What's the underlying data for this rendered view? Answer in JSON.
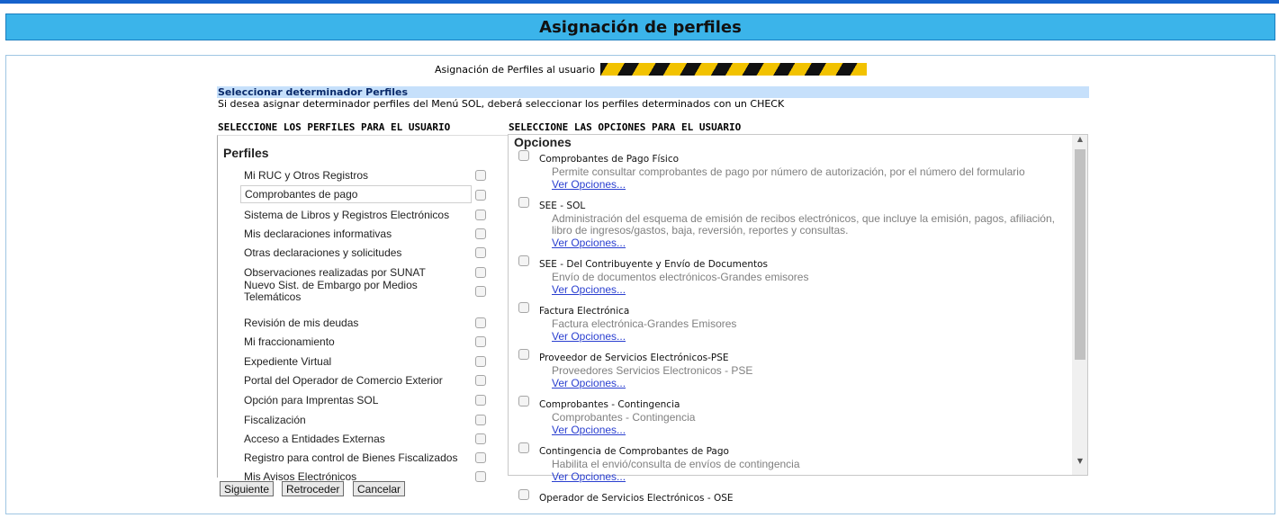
{
  "header": {
    "title": "Asignación de perfiles"
  },
  "user_row": {
    "label": "Asignación de Perfiles al usuario"
  },
  "section": {
    "heading": "Seleccionar determinador Perfiles",
    "description": "Si desea asignar determinador perfiles del Menú SOL, deberá seleccionar los perfiles determinados con un CHECK"
  },
  "perfiles": {
    "column_header": "SELECCIONE LOS PERFILES PARA EL USUARIO",
    "title": "Perfiles",
    "items": [
      {
        "label": "Mi RUC y Otros Registros"
      },
      {
        "label": "Comprobantes de pago"
      },
      {
        "label": "Sistema de Libros y Registros Electrónicos"
      },
      {
        "label": "Mis declaraciones informativas"
      },
      {
        "label": "Otras declaraciones y solicitudes"
      },
      {
        "label": "Observaciones realizadas por SUNAT"
      },
      {
        "label": "Nuevo Sist. de Embargo por Medios Telemáticos"
      },
      {
        "label": "Revisión de mis deudas"
      },
      {
        "label": "Mi fraccionamiento"
      },
      {
        "label": "Expediente Virtual"
      },
      {
        "label": "Portal del Operador de Comercio Exterior"
      },
      {
        "label": "Opción para Imprentas SOL"
      },
      {
        "label": "Fiscalización"
      },
      {
        "label": "Acceso a Entidades Externas"
      },
      {
        "label": "Registro para control de Bienes Fiscalizados"
      },
      {
        "label": "Mis Avisos Electrónicos"
      }
    ]
  },
  "opciones": {
    "column_header": "SELECCIONE LAS OPCIONES PARA EL USUARIO",
    "title": "Opciones",
    "link_label": "Ver Opciones...",
    "items": [
      {
        "title": "Comprobantes de Pago Físico",
        "desc": [
          "Permite consultar comprobantes de pago por número de autorización, por el número del formulario"
        ]
      },
      {
        "title": "SEE - SOL",
        "desc": [
          "Administración del esquema de emisión de recibos electrónicos, que incluye la emisión, pagos, afiliación,",
          "libro de ingresos/gastos, baja, reversión, reportes y consultas."
        ]
      },
      {
        "title": "SEE - Del Contribuyente y Envío de Documentos",
        "desc": [
          "Envío de documentos electrónicos-Grandes emisores"
        ]
      },
      {
        "title": "Factura Electrónica",
        "desc": [
          "Factura electrónica-Grandes Emisores"
        ]
      },
      {
        "title": "Proveedor de Servicios Electrónicos-PSE",
        "desc": [
          "Proveedores Servicios Electronicos - PSE"
        ]
      },
      {
        "title": "Comprobantes - Contingencia",
        "desc": [
          "Comprobantes - Contingencia"
        ]
      },
      {
        "title": "Contingencia de Comprobantes de Pago",
        "desc": [
          "Habilita el envió/consulta de envíos de contingencia"
        ]
      },
      {
        "title": "Operador de Servicios Electrónicos - OSE",
        "desc": []
      }
    ]
  },
  "buttons": {
    "next": "Siguiente",
    "back": "Retroceder",
    "cancel": "Cancelar"
  }
}
